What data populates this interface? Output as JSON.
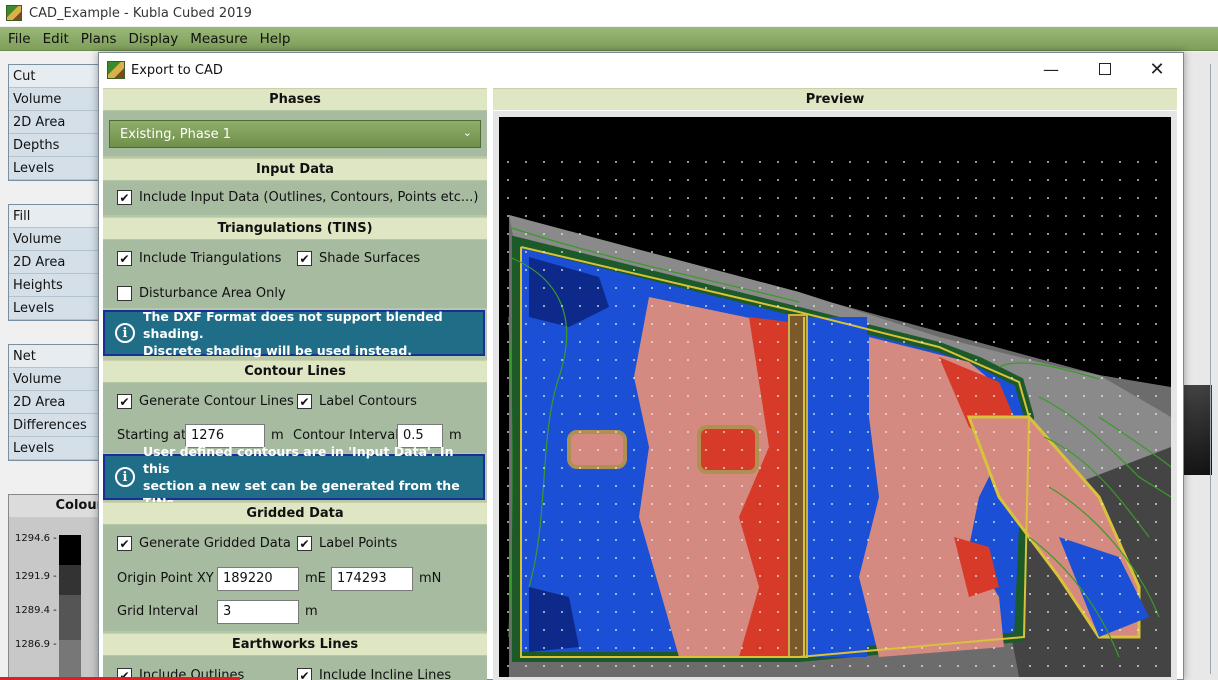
{
  "app": {
    "title": "CAD_Example - Kubla Cubed 2019",
    "menu": [
      "File",
      "Edit",
      "Plans",
      "Display",
      "Measure",
      "Help"
    ]
  },
  "sidebar": {
    "cut": [
      "Cut",
      "Volume",
      "2D Area",
      "Depths",
      "Levels"
    ],
    "fill": [
      "Fill",
      "Volume",
      "2D Area",
      "Heights",
      "Levels"
    ],
    "net": [
      "Net",
      "Volume",
      "2D Area",
      "Differences",
      "Levels"
    ],
    "colour_title": "Colour",
    "colour_labels": [
      "1294.6 -",
      "1291.9 -",
      "1289.4 -",
      "1286.9 -"
    ]
  },
  "dialog": {
    "title": "Export to CAD",
    "phases": {
      "header": "Phases",
      "selected": "Existing, Phase 1"
    },
    "input_data": {
      "header": "Input Data",
      "include_label": "Include Input Data (Outlines, Contours, Points etc...)",
      "include_checked": true
    },
    "triangulations": {
      "header": "Triangulations (TINS)",
      "include_label": "Include Triangulations",
      "include_checked": true,
      "shade_label": "Shade Surfaces",
      "shade_checked": true,
      "disturbance_label": "Disturbance Area Only",
      "disturbance_checked": false,
      "info_line1": "The DXF Format does not support blended shading.",
      "info_line2": "Discrete shading will be used instead."
    },
    "contours": {
      "header": "Contour Lines",
      "generate_label": "Generate Contour Lines",
      "generate_checked": true,
      "label_label": "Label Contours",
      "label_checked": true,
      "start_label": "Starting at",
      "start_value": "1276",
      "start_unit": "m",
      "interval_label": "Contour Interval",
      "interval_value": "0.5",
      "interval_unit": "m",
      "info_line1": "User defined contours are in 'Input Data'. In this",
      "info_line2": "section a new set can be generated from the TINs."
    },
    "gridded": {
      "header": "Gridded Data",
      "generate_label": "Generate Gridded Data",
      "generate_checked": true,
      "label_label": "Label Points",
      "label_checked": true,
      "origin_label": "Origin Point XY",
      "origin_x": "189220",
      "origin_x_unit": "mE",
      "origin_y": "174293",
      "origin_y_unit": "mN",
      "interval_label": "Grid Interval",
      "interval_value": "3",
      "interval_unit": "m"
    },
    "earthworks": {
      "header": "Earthworks Lines",
      "outlines_label": "Include Outlines",
      "incline_label": "Include Incline Lines"
    },
    "preview": {
      "header": "Preview"
    }
  },
  "colors": {
    "cut_blue": "#1a4fd6",
    "fill_red": "#d83a2a",
    "pink": "#d48a80",
    "outline_yellow": "#d9c23a",
    "contour_green": "#3a9a2a"
  }
}
